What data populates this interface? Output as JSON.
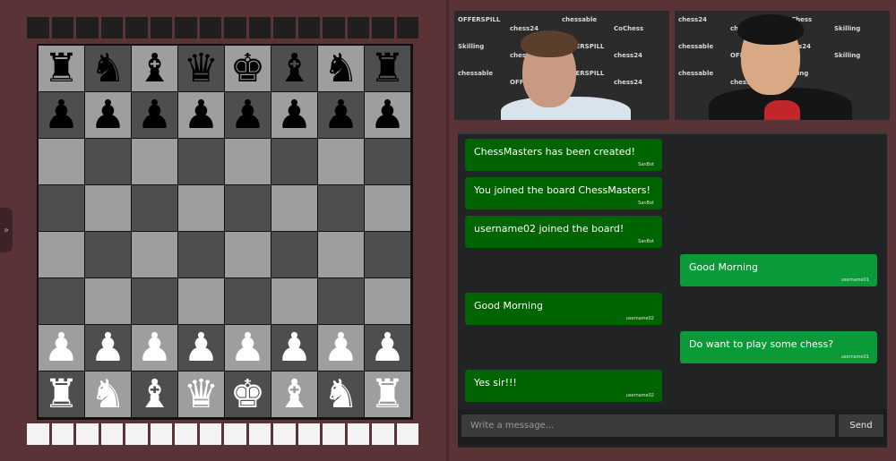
{
  "board": {
    "rows": [
      [
        {
          "p": "♜",
          "c": "black"
        },
        {
          "p": "♞",
          "c": "black"
        },
        {
          "p": "♝",
          "c": "black"
        },
        {
          "p": "♛",
          "c": "black"
        },
        {
          "p": "♚",
          "c": "black"
        },
        {
          "p": "♝",
          "c": "black"
        },
        {
          "p": "♞",
          "c": "black"
        },
        {
          "p": "♜",
          "c": "black"
        }
      ],
      [
        {
          "p": "♟",
          "c": "black"
        },
        {
          "p": "♟",
          "c": "black"
        },
        {
          "p": "♟",
          "c": "black"
        },
        {
          "p": "♟",
          "c": "black"
        },
        {
          "p": "♟",
          "c": "black"
        },
        {
          "p": "♟",
          "c": "black"
        },
        {
          "p": "♟",
          "c": "black"
        },
        {
          "p": "♟",
          "c": "black"
        }
      ],
      [
        null,
        null,
        null,
        null,
        null,
        null,
        null,
        null
      ],
      [
        null,
        null,
        null,
        null,
        null,
        null,
        null,
        null
      ],
      [
        null,
        null,
        null,
        null,
        null,
        null,
        null,
        null
      ],
      [
        null,
        null,
        null,
        null,
        null,
        null,
        null,
        null
      ],
      [
        {
          "p": "♟",
          "c": "white"
        },
        {
          "p": "♟",
          "c": "white"
        },
        {
          "p": "♟",
          "c": "white"
        },
        {
          "p": "♟",
          "c": "white"
        },
        {
          "p": "♟",
          "c": "white"
        },
        {
          "p": "♟",
          "c": "white"
        },
        {
          "p": "♟",
          "c": "white"
        },
        {
          "p": "♟",
          "c": "white"
        }
      ],
      [
        {
          "p": "♜",
          "c": "white"
        },
        {
          "p": "♞",
          "c": "white"
        },
        {
          "p": "♝",
          "c": "white"
        },
        {
          "p": "♛",
          "c": "white"
        },
        {
          "p": "♚",
          "c": "white"
        },
        {
          "p": "♝",
          "c": "white"
        },
        {
          "p": "♞",
          "c": "white"
        },
        {
          "p": "♜",
          "c": "white"
        }
      ]
    ],
    "light_color": "#9e9e9e",
    "dark_color": "#4e4e4e"
  },
  "captured": {
    "top_slots": 16,
    "bottom_slots": 16
  },
  "sidebar_toggle": {
    "label": "»"
  },
  "video_feeds": {
    "left": {
      "sponsors": [
        "OFFERSPILL",
        "chess24",
        "chessable",
        "CoChess",
        "Skilling",
        "chessable",
        "OFFERSPILL",
        "chess24",
        "chessable",
        "OFFERSPILL",
        "OFFERSPILL",
        "chess24"
      ]
    },
    "right": {
      "sponsors": [
        "chess24",
        "chessable",
        "CoChess",
        "Skilling",
        "chessable",
        "OFFERSPILL",
        "chess24",
        "Skilling",
        "chessable",
        "chessable",
        "Skilling"
      ]
    }
  },
  "chat": {
    "messages": [
      {
        "text": "ChessMasters has been created!",
        "user": "SanBot",
        "side": "left"
      },
      {
        "text": "You joined the board ChessMasters!",
        "user": "SanBot",
        "side": "left"
      },
      {
        "text": "username02 joined the board!",
        "user": "SanBot",
        "side": "left"
      },
      {
        "text": "Good Morning",
        "user": "username01",
        "side": "right"
      },
      {
        "text": "Good Morning",
        "user": "username02",
        "side": "left"
      },
      {
        "text": "Do want to play some chess?",
        "user": "username01",
        "side": "right"
      },
      {
        "text": "Yes sir!!!",
        "user": "username02",
        "side": "left"
      }
    ],
    "input_placeholder": "Write a message...",
    "send_label": "Send",
    "colors": {
      "incoming": "#006400",
      "outgoing": "#0a9a38",
      "background": "#222324"
    }
  }
}
